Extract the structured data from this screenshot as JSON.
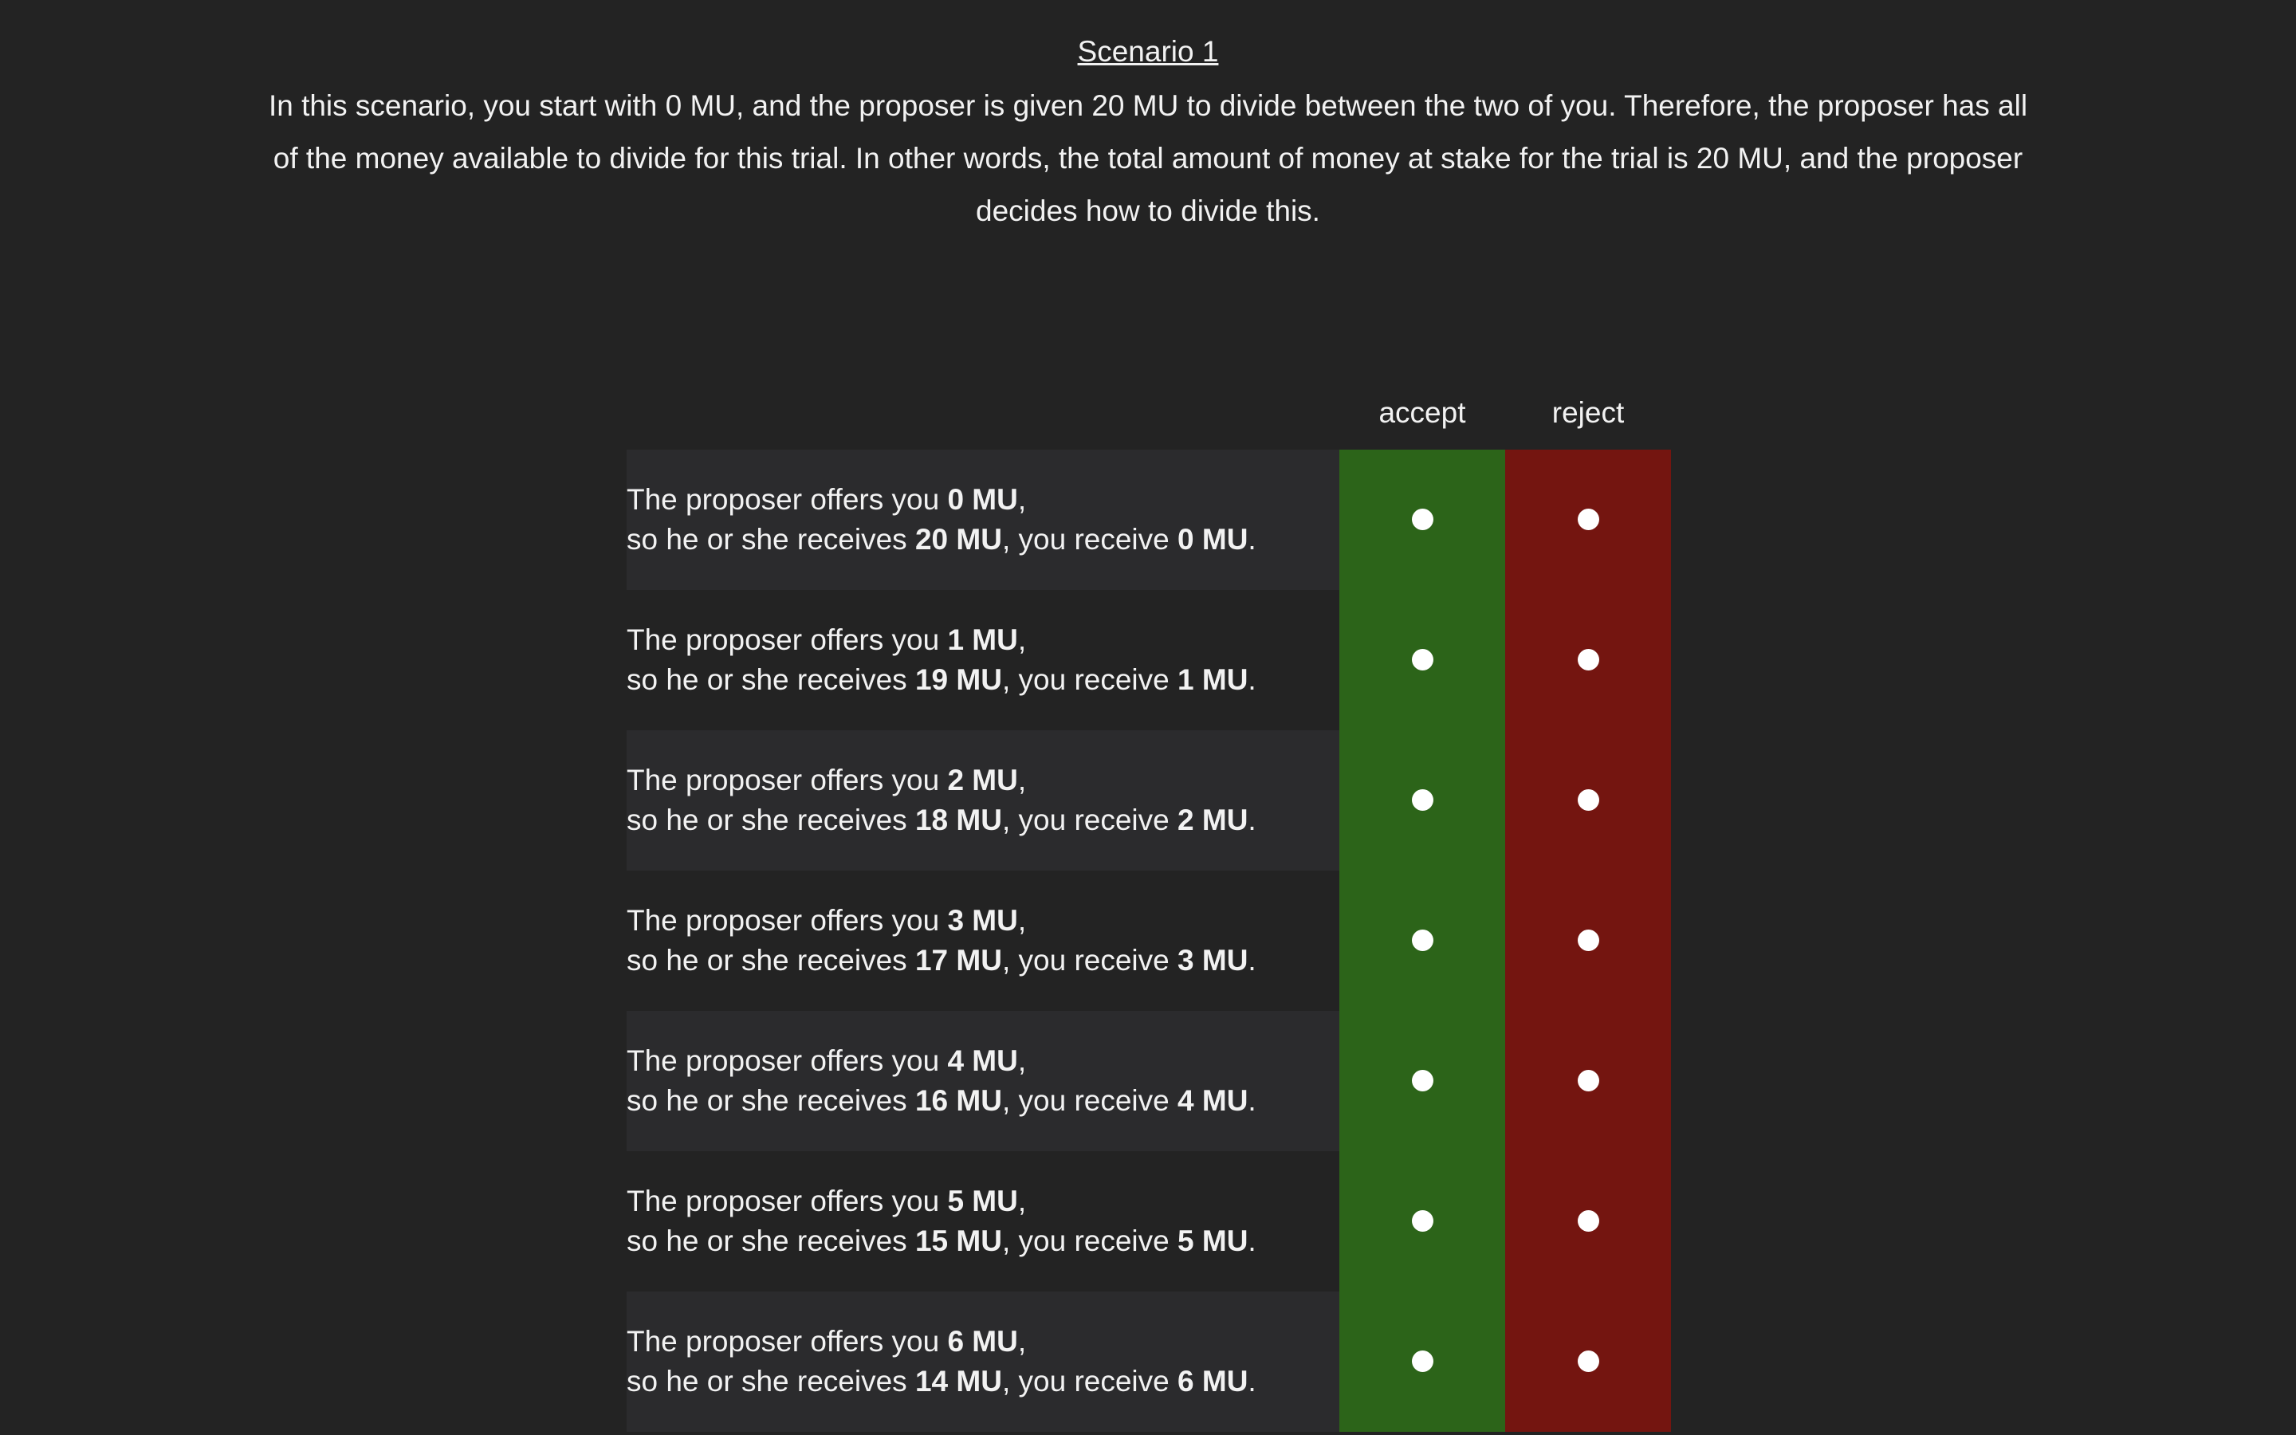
{
  "scenario": {
    "title": "Scenario 1",
    "intro": "In this scenario, you start with 0 MU, and the proposer is given 20 MU to divide between the two of you. Therefore, the proposer has all of the money available to divide for this trial. In other words, the total amount of money at stake for the trial is 20 MU, and the proposer decides how to divide this."
  },
  "table": {
    "accept_label": "accept",
    "reject_label": "reject",
    "line1_prefix": "The proposer offers you ",
    "line1_suffix": ",",
    "line2_prefix": "so he or she receives ",
    "line2_middle": ", you receive ",
    "line2_suffix": ".",
    "rows": [
      {
        "offer": "0 MU",
        "proposer": "20 MU",
        "you": "0 MU"
      },
      {
        "offer": "1 MU",
        "proposer": "19 MU",
        "you": "1 MU"
      },
      {
        "offer": "2 MU",
        "proposer": "18 MU",
        "you": "2 MU"
      },
      {
        "offer": "3 MU",
        "proposer": "17 MU",
        "you": "3 MU"
      },
      {
        "offer": "4 MU",
        "proposer": "16 MU",
        "you": "4 MU"
      },
      {
        "offer": "5 MU",
        "proposer": "15 MU",
        "you": "5 MU"
      },
      {
        "offer": "6 MU",
        "proposer": "14 MU",
        "you": "6 MU"
      }
    ]
  },
  "colors": {
    "background": "#232323",
    "accept": "#2c6419",
    "reject": "#741510",
    "row_stripe": "#2b2b2d"
  }
}
